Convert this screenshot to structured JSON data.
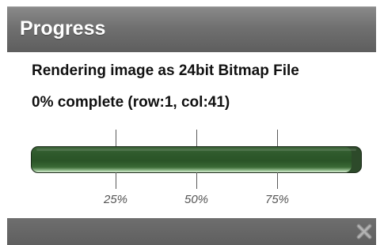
{
  "dialog": {
    "title": "Progress",
    "message": "Rendering image as 24bit Bitmap File",
    "status": "0% complete (row:1, col:41)"
  },
  "progress": {
    "percent": 0.97,
    "ticks": [
      {
        "label": "25%"
      },
      {
        "label": "50%"
      },
      {
        "label": "75%"
      }
    ]
  },
  "footer": {
    "close_icon": "close-icon"
  },
  "colors": {
    "titlebar": "#707070",
    "footer": "#5f5f5f",
    "bar": "#2f5a2c",
    "bar_highlight": "#dff0db"
  }
}
